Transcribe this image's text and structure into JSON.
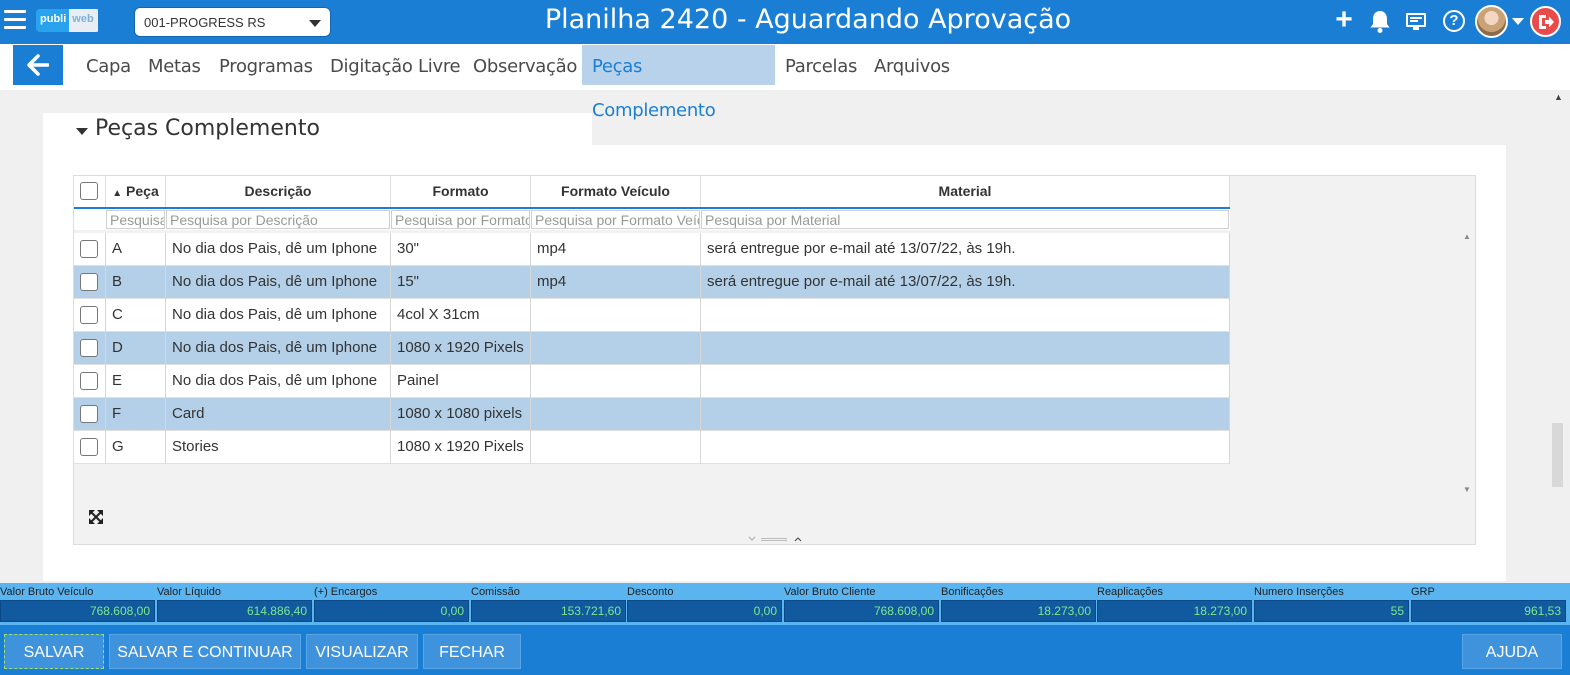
{
  "header": {
    "logo_left": "publi",
    "logo_right": "web",
    "client_select": "001-PROGRESS RS",
    "title": "Planilha 2420 - Aguardando Aprovação",
    "icons": [
      "menu-icon",
      "plus-icon",
      "bell-icon",
      "monitor-icon",
      "help-icon",
      "avatar",
      "chevron-down-icon",
      "logout-icon"
    ]
  },
  "tabs": [
    {
      "label": "Capa"
    },
    {
      "label": "Metas"
    },
    {
      "label": "Programas"
    },
    {
      "label": "Digitação Livre"
    },
    {
      "label": "Observação"
    },
    {
      "label": "Peças Complemento",
      "active": true
    },
    {
      "label": "Parcelas"
    },
    {
      "label": "Arquivos"
    }
  ],
  "section": {
    "title": "Peças Complemento"
  },
  "table": {
    "columns": [
      {
        "label": "Peça",
        "sort": "asc",
        "placeholder": "Pesquisa por Peça"
      },
      {
        "label": "Descrição",
        "placeholder": "Pesquisa por Descrição"
      },
      {
        "label": "Formato",
        "placeholder": "Pesquisa por Formato"
      },
      {
        "label": "Formato Veículo",
        "placeholder": "Pesquisa por Formato Veículo"
      },
      {
        "label": "Material",
        "placeholder": "Pesquisa por Material"
      }
    ],
    "sort_arrow": "▲",
    "rows": [
      {
        "peca": "A",
        "descricao": "No dia dos Pais, dê um Iphone",
        "formato": "30\"",
        "formato_veiculo": "mp4",
        "material": "será entregue por e-mail até 13/07/22, às 19h."
      },
      {
        "peca": "B",
        "descricao": "No dia dos Pais, dê um Iphone",
        "formato": "15\"",
        "formato_veiculo": "mp4",
        "material": "será entregue por e-mail até 13/07/22, às 19h."
      },
      {
        "peca": "C",
        "descricao": "No dia dos Pais, dê um Iphone",
        "formato": "4col X 31cm",
        "formato_veiculo": "",
        "material": ""
      },
      {
        "peca": "D",
        "descricao": "No dia dos Pais, dê um Iphone",
        "formato": "1080 x 1920 Pixels",
        "formato_veiculo": "",
        "material": ""
      },
      {
        "peca": "E",
        "descricao": "No dia dos Pais, dê um Iphone",
        "formato": "Painel",
        "formato_veiculo": "",
        "material": ""
      },
      {
        "peca": "F",
        "descricao": "Card",
        "formato": "1080 x 1080 pixels",
        "formato_veiculo": "",
        "material": ""
      },
      {
        "peca": "G",
        "descricao": "Stories",
        "formato": "1080 x 1920 Pixels",
        "formato_veiculo": "",
        "material": ""
      }
    ]
  },
  "totals": [
    {
      "label": "Valor Bruto Veículo",
      "value": "768.608,00"
    },
    {
      "label": "Valor Líquido",
      "value": "614.886,40"
    },
    {
      "label": "(+) Encargos",
      "value": "0,00"
    },
    {
      "label": "Comissão",
      "value": "153.721,60"
    },
    {
      "label": "Desconto",
      "value": "0,00"
    },
    {
      "label": "Valor Bruto Cliente",
      "value": "768.608,00"
    },
    {
      "label": "Bonificações",
      "value": "18.273,00"
    },
    {
      "label": "Reaplicações",
      "value": "18.273,00"
    },
    {
      "label": "Numero Inserções",
      "value": "55"
    },
    {
      "label": "GRP",
      "value": "961,53"
    }
  ],
  "footer": {
    "save": "SALVAR",
    "save_continue": "SALVAR E CONTINUAR",
    "view": "VISUALIZAR",
    "close": "FECHAR",
    "help": "AJUDA"
  },
  "colors": {
    "primary": "#1a7fd4",
    "active_tab_bg": "#b7d2ea",
    "striped_row": "#b3d0e8",
    "totals_bar": "#5ab4f0",
    "totals_value": "#7ce88a",
    "logout": "#e94b4b"
  }
}
